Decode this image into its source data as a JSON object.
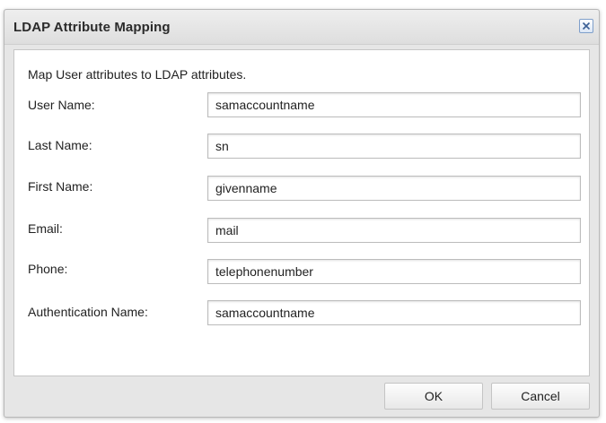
{
  "dialog": {
    "title": "LDAP Attribute Mapping",
    "close_icon": "close-icon",
    "intro": "Map User attributes to LDAP attributes.",
    "fields": [
      {
        "label": "User Name:",
        "value": "samaccountname"
      },
      {
        "label": "Last Name:",
        "value": "sn"
      },
      {
        "label": "First Name:",
        "value": "givenname"
      },
      {
        "label": "Email:",
        "value": "mail"
      },
      {
        "label": "Phone:",
        "value": "telephonenumber"
      },
      {
        "label": "Authentication Name:",
        "value": "samaccountname"
      }
    ],
    "buttons": {
      "ok": "OK",
      "cancel": "Cancel"
    }
  }
}
